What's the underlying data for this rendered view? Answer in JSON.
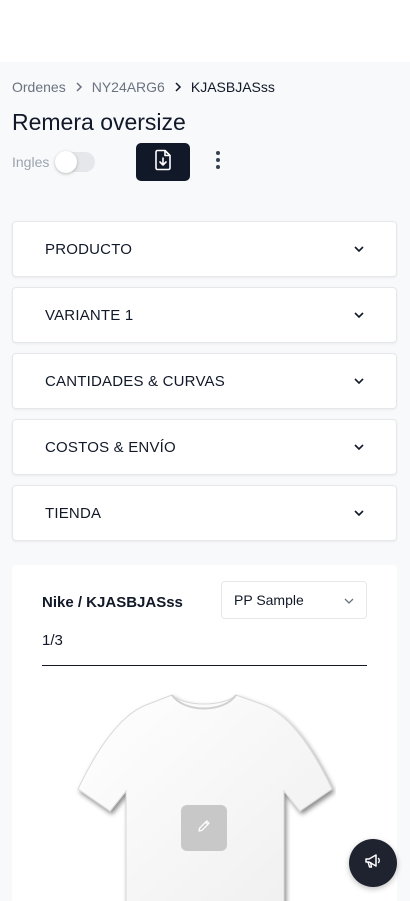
{
  "breadcrumb": {
    "items": [
      "Ordenes",
      "NY24ARG6",
      "KJASBJASss"
    ]
  },
  "page": {
    "title": "Remera oversize"
  },
  "language_toggle": {
    "label": "Ingles",
    "enabled": false
  },
  "toolbar": {
    "download_icon": "file-download-icon",
    "more_icon": "more-vertical-icon"
  },
  "sections": [
    {
      "label": "PRODUCTO"
    },
    {
      "label": "VARIANTE 1"
    },
    {
      "label": "CANTIDADES & CURVAS"
    },
    {
      "label": "COSTOS & ENVÍO"
    },
    {
      "label": "TIENDA"
    }
  ],
  "preview_card": {
    "title": "Nike / KJASBJASss",
    "sample_select": "PP Sample",
    "pager": "1/3",
    "image": "white-tshirt",
    "edit_icon": "pencil-icon"
  },
  "fab": {
    "icon": "megaphone-icon"
  },
  "colors": {
    "primary_dark": "#111827",
    "background": "#f8f9fb",
    "border": "#e5e7eb"
  }
}
